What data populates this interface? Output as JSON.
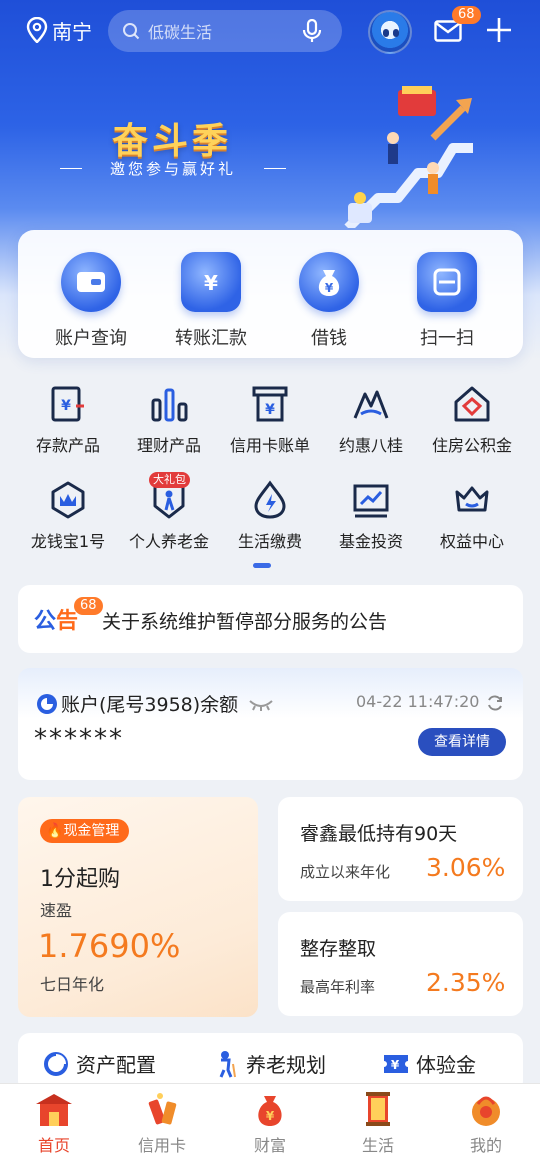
{
  "topbar": {
    "city": "南宁",
    "search_placeholder": "低碳生活",
    "mail_badge": "68"
  },
  "banner": {
    "title": "奋斗季",
    "subtitle": "邀您参与赢好礼"
  },
  "quick_actions": [
    {
      "label": "账户查询",
      "icon": "wallet-icon"
    },
    {
      "label": "转账汇款",
      "icon": "yuan-card-icon"
    },
    {
      "label": "借钱",
      "icon": "money-bag-icon"
    },
    {
      "label": "扫一扫",
      "icon": "scan-icon"
    }
  ],
  "services": [
    {
      "label": "存款产品",
      "icon": "deposit-icon"
    },
    {
      "label": "理财产品",
      "icon": "bar-chart-icon"
    },
    {
      "label": "信用卡账单",
      "icon": "bill-icon"
    },
    {
      "label": "约惠八桂",
      "icon": "mountain-icon"
    },
    {
      "label": "住房公积金",
      "icon": "house-icon"
    },
    {
      "label": "龙钱宝1号",
      "icon": "crown-icon"
    },
    {
      "label": "个人养老金",
      "icon": "elder-icon",
      "tag": "大礼包"
    },
    {
      "label": "生活缴费",
      "icon": "lightning-drop-icon"
    },
    {
      "label": "基金投资",
      "icon": "trend-chart-icon"
    },
    {
      "label": "权益中心",
      "icon": "crown-cup-icon"
    }
  ],
  "notice": {
    "logo_a": "公",
    "logo_b": "告",
    "badge": "68",
    "text": "关于系统维护暂停部分服务的公告"
  },
  "account": {
    "title": "账户(尾号3958)余额",
    "time": "04-22 11:47:20",
    "balance_masked": "******",
    "detail_button": "查看详情"
  },
  "cash_card": {
    "tag": "现金管理",
    "title": "1分起购",
    "product": "速盈",
    "rate": "1.7690%",
    "rate_label": "七日年化"
  },
  "products": [
    {
      "name": "睿鑫最低持有90天",
      "sub": "成立以来年化",
      "rate": "3.06%"
    },
    {
      "name": "整存整取",
      "sub": "最高年利率",
      "rate": "2.35%"
    }
  ],
  "tools": [
    {
      "label": "资产配置",
      "icon": "pie-icon"
    },
    {
      "label": "养老规划",
      "icon": "elder-walk-icon"
    },
    {
      "label": "体验金",
      "icon": "ticket-icon"
    }
  ],
  "tabs": [
    {
      "label": "首页",
      "active": true
    },
    {
      "label": "信用卡",
      "active": false
    },
    {
      "label": "财富",
      "active": false
    },
    {
      "label": "生活",
      "active": false
    },
    {
      "label": "我的",
      "active": false
    }
  ],
  "colors": {
    "primary_blue": "#2a5ee0",
    "accent_orange": "#f47a1f",
    "tab_active": "#e8452c"
  }
}
